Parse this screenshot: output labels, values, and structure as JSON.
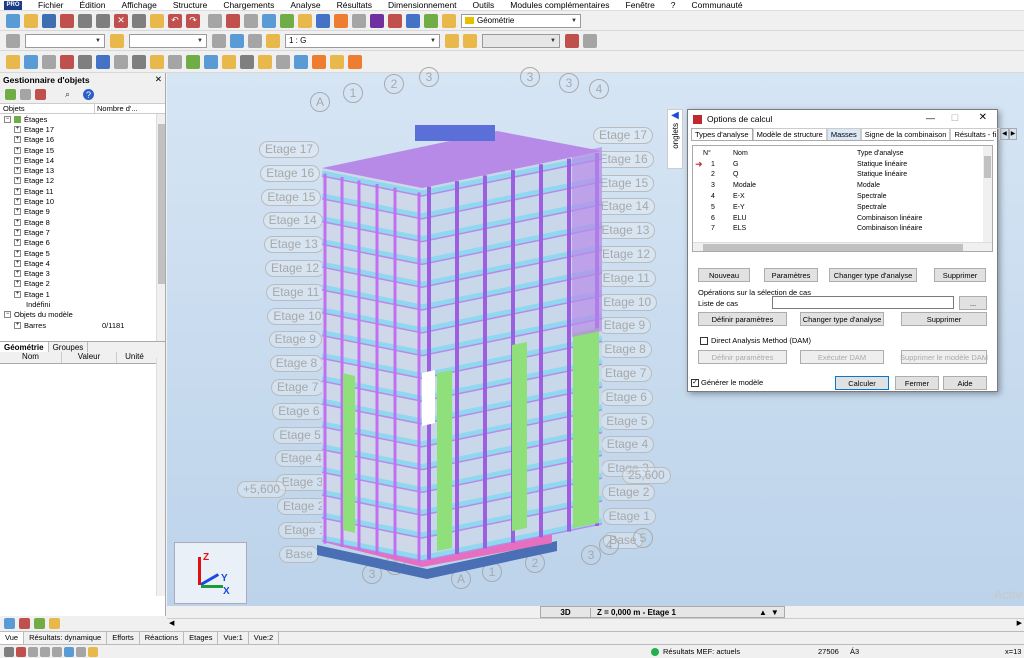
{
  "menu": [
    "Fichier",
    "Édition",
    "Affichage",
    "Structure",
    "Chargements",
    "Analyse",
    "Résultats",
    "Dimensionnement",
    "Outils",
    "Modules complémentaires",
    "Fenêtre",
    "?",
    "Communauté"
  ],
  "logo": "PRO",
  "toolbar": {
    "layout_select": "Géométrie",
    "case_select": "1 : G"
  },
  "left_panel": {
    "title": "Gestionnaire d'objets",
    "col_objets": "Objets",
    "col_nombre": "Nombre d'...",
    "tree": {
      "etages": "Étages",
      "items": [
        "Etage 17",
        "Etage 16",
        "Etage 15",
        "Etage 14",
        "Etage 13",
        "Etage 12",
        "Etage 11",
        "Etage 10",
        "Etage 9",
        "Etage 8",
        "Etage 7",
        "Etage 6",
        "Etage 5",
        "Etage 4",
        "Etage 3",
        "Etage 2",
        "Etage 1"
      ],
      "indefini": "Indéfini",
      "objets_modele": "Objets du modèle",
      "barres": "Barres",
      "barres_count": "0/1181"
    },
    "tabs": [
      "Géométrie",
      "Groupes"
    ],
    "props_cols": [
      "Nom",
      "Valeur",
      "Unité"
    ]
  },
  "viewport": {
    "floor_left": [
      "Etage 17",
      "Etage 16",
      "Etage 15",
      "Etage 14",
      "Etage 13",
      "Etage 12",
      "Etage 11",
      "Etage 10",
      "Etage 9",
      "Etage 8",
      "Etage 7",
      "Etage 6",
      "Etage 5",
      "Etage 4",
      "Etage 3",
      "Etage 2",
      "Etage 1",
      "Base"
    ],
    "floor_right": [
      "Etage 17",
      "Etage 16",
      "Etage 15",
      "Etage 14",
      "Etage 13",
      "Etage 12",
      "Etage 11",
      "Etage 10",
      "Etage 9",
      "Etage 8",
      "Etage 7",
      "Etage 6",
      "Etage 5",
      "Etage 4",
      "Etage 3",
      "Etage 2",
      "Etage 1",
      "Base"
    ],
    "grid_top": [
      "A",
      "1",
      "2",
      "3",
      "3",
      "3",
      "4"
    ],
    "grid_bottom": [
      "A",
      "1",
      "2",
      "3",
      "3",
      "3",
      "4",
      "5"
    ],
    "dim_left": "+5,600",
    "dim_right": "25,600",
    "view_mode": "3D",
    "z_info": "Z = 0,000 m - Etage 1",
    "axis_z": "Z",
    "axis_y": "Y",
    "axis_x": "X",
    "onglets": "onglets",
    "watermark": "Activ"
  },
  "dialog": {
    "title": "Options de calcul",
    "tabs": [
      "Types d'analyse",
      "Modèle de structure",
      "Masses",
      "Signe de la combinaison",
      "Résultats - fi"
    ],
    "headers": {
      "no": "N°",
      "nom": "Nom",
      "type": "Type d'analyse"
    },
    "rows": [
      {
        "no": "1",
        "nom": "G",
        "type": "Statique linéaire"
      },
      {
        "no": "2",
        "nom": "Q",
        "type": "Statique linéaire"
      },
      {
        "no": "3",
        "nom": "Modale",
        "type": "Modale"
      },
      {
        "no": "4",
        "nom": "E-X",
        "type": "Spectrale"
      },
      {
        "no": "5",
        "nom": "E-Y",
        "type": "Spectrale"
      },
      {
        "no": "6",
        "nom": "ELU",
        "type": "Combinaison linéaire"
      },
      {
        "no": "7",
        "nom": "ELS",
        "type": "Combinaison linéaire"
      }
    ],
    "btn_nouveau": "Nouveau",
    "btn_parametres": "Paramètres",
    "btn_changer": "Changer type d'analyse",
    "btn_supprimer": "Supprimer",
    "ops_title": "Opérations sur la sélection de cas",
    "liste_cas": "Liste de cas",
    "btn_dots": "...",
    "btn_definir": "Définir paramètres",
    "btn_changer2": "Changer type d'analyse",
    "btn_supprimer2": "Supprimer",
    "dam_label": "Direct Analysis Method (DAM)",
    "btn_def_dam": "Définir paramètres",
    "btn_exec_dam": "Exécuter DAM",
    "btn_supp_dam": "Supprimer le modèle DAM",
    "generer": "Générer le modèle",
    "btn_calculer": "Calculer",
    "btn_fermer": "Fermer",
    "btn_aide": "Aide"
  },
  "bottom_tabs": [
    "Vue",
    "Résultats: dynamique",
    "Efforts",
    "Réactions",
    "Etages",
    "Vue:1",
    "Vue:2"
  ],
  "status": {
    "results": "Résultats MEF: actuels",
    "number": "27506",
    "unit": "Á3",
    "coord": "x=13"
  },
  "colors": {
    "menu_bg": "#ffffff",
    "viewport_top": "#d6e5f4",
    "dialog_accent": "#0078d7",
    "slab_purple": "#b88ae8",
    "column_green": "#8fe07a",
    "beam_cyan": "#8fd8f0",
    "base_pink": "#e66fc0"
  }
}
